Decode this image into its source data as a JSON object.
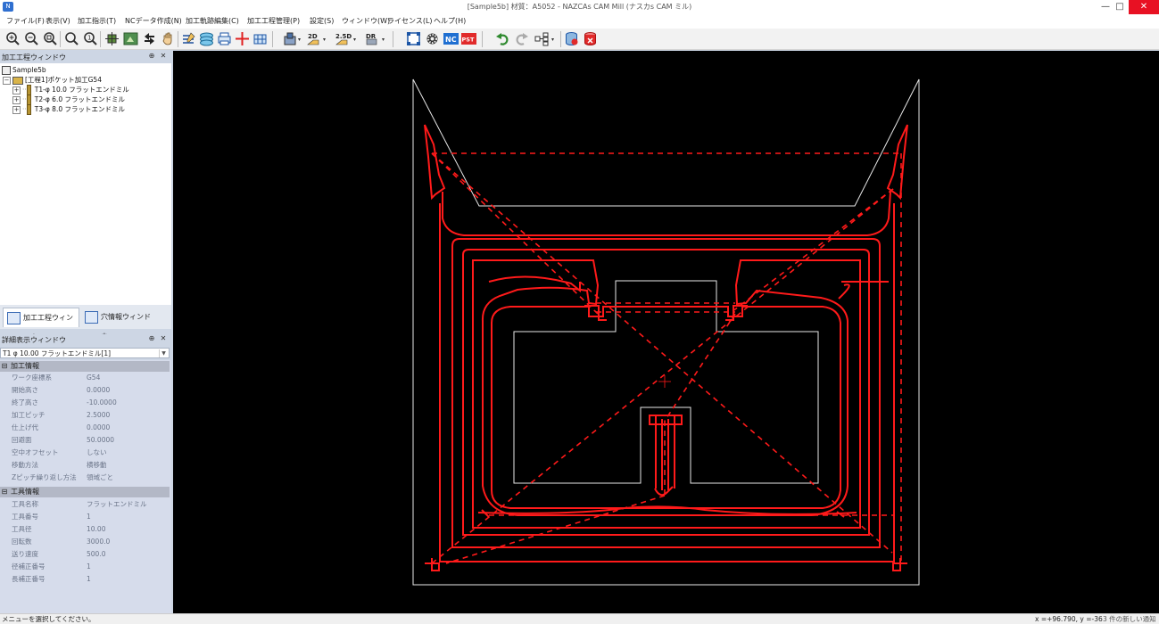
{
  "window": {
    "title": "[Sample5b] 材質：A5052 - NAZCAs CAM Mill (ナスカs CAM ミル)",
    "app_icon": "nazca-app-icon",
    "minimize_glyph": "—",
    "maximize_glyph": "□",
    "close_glyph": "✕"
  },
  "menu": [
    "ファイル(F)",
    "表示(V)",
    "加工指示(T)",
    "NCデータ作成(N)",
    "加工軌跡編集(C)",
    "加工工程管理(P)",
    "設定(S)",
    "ウィンドウ(W)",
    "ライセンス(L)",
    "ヘルプ(H)"
  ],
  "toolbar": {
    "icons": [
      "zoom-in-icon",
      "zoom-out-icon",
      "zoom-window-icon",
      "zoom-icon",
      "zoom-all-icon",
      "pan-cross-icon",
      "fit-view-icon",
      "rotate-icon",
      "hand-pan-icon",
      "edit-path-icon",
      "layers-icon",
      "print-icon",
      "origin-icon",
      "grid-icon",
      "pocket-icon",
      "2d-contour-icon",
      "2-5d-icon",
      "drill-icon",
      "frame-icon",
      "gear-icon",
      "nc-icon",
      "pst-icon",
      "undo-icon",
      "redo-icon",
      "tree-icon",
      "save-icon",
      "delete-icon"
    ],
    "labels": {
      "nc": "NC",
      "pst": "PST",
      "2d": "2D",
      "2_5d": "2.5D",
      "dr": "DR"
    }
  },
  "process_panel": {
    "title": "加工工程ウィンドウ",
    "pin_glyph": "⊕",
    "close_glyph": "✕",
    "tree": {
      "root": "Sample5b",
      "process": "[工程1]ポケット加工G54",
      "tools": [
        "T1-φ 10.0 フラットエンドミル",
        "T2-φ 6.0 フラットエンドミル",
        "T3-φ 8.0 フラットエンドミル"
      ]
    },
    "tabs": [
      "加工工程ウィンドウ",
      "穴情報ウィンドウ"
    ]
  },
  "detail_panel": {
    "title": "詳細表示ウィンドウ",
    "pin_glyph": "⊕",
    "close_glyph": "✕",
    "selected": "T1 φ 10.00 フラットエンドミル[1]",
    "sections": [
      {
        "name": "加工情報",
        "sign": "⊟",
        "rows": [
          {
            "k": "ワーク座標系",
            "v": "G54"
          },
          {
            "k": "開始高さ",
            "v": "0.0000"
          },
          {
            "k": "終了高さ",
            "v": "-10.0000"
          },
          {
            "k": "加工ピッチ",
            "v": "2.5000"
          },
          {
            "k": "仕上げ代",
            "v": "0.0000"
          },
          {
            "k": "回避面",
            "v": "50.0000"
          },
          {
            "k": "空中オフセット",
            "v": "しない"
          },
          {
            "k": "移動方法",
            "v": "横移動"
          },
          {
            "k": "Zピッチ繰り返し方法",
            "v": "領域ごと"
          }
        ]
      },
      {
        "name": "工具情報",
        "sign": "⊟",
        "rows": [
          {
            "k": "工具名称",
            "v": "フラットエンドミル"
          },
          {
            "k": "工具番号",
            "v": "1"
          },
          {
            "k": "工具径",
            "v": "10.00"
          },
          {
            "k": "回転数",
            "v": "3000.0"
          },
          {
            "k": "送り速度",
            "v": "500.0"
          },
          {
            "k": "径補正番号",
            "v": "1"
          },
          {
            "k": "長補正番号",
            "v": "1"
          }
        ]
      }
    ]
  },
  "status": {
    "message": "メニューを選択してください。",
    "coords": "x =+96.790,   y =-36",
    "extra": "3 件の新しい通知"
  },
  "colors": {
    "toolpath": "#ff1a1a",
    "outline": "#e8e8e8",
    "canvas": "#000000",
    "panel_bg": "#cdd6e4"
  }
}
